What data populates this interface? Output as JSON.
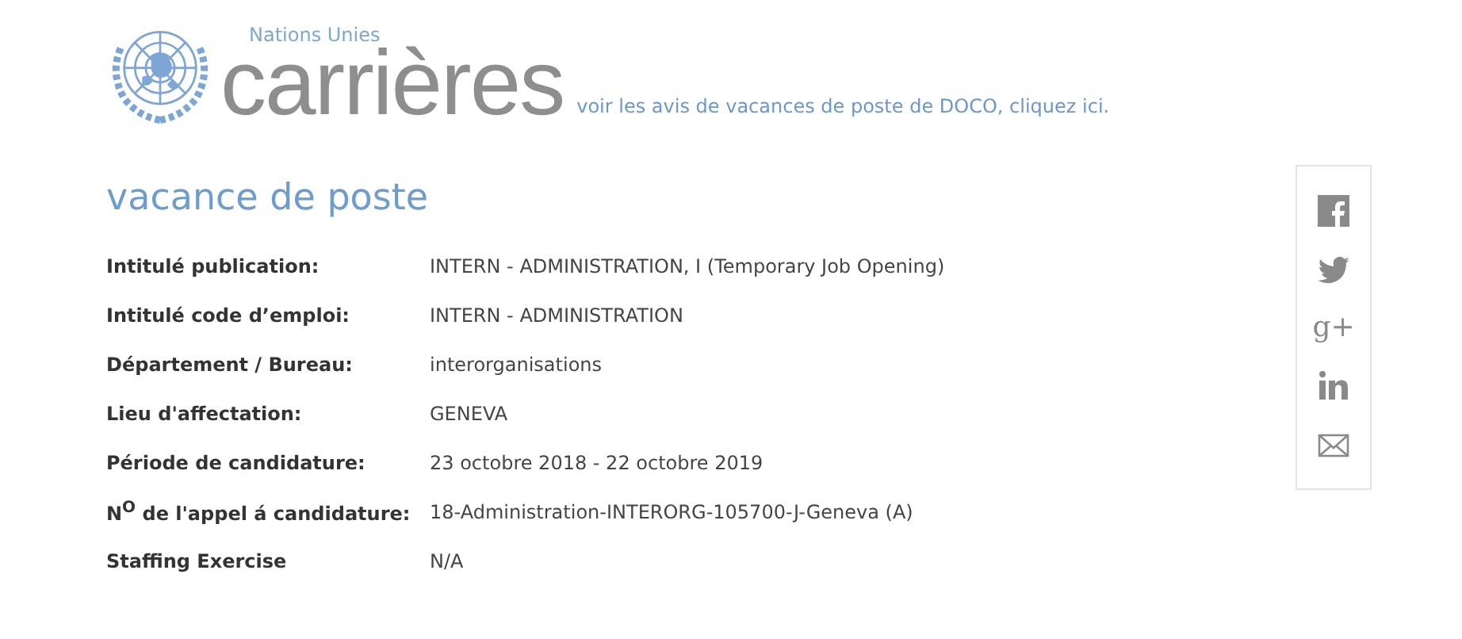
{
  "header": {
    "org": "Nations Unies",
    "title": "carrières",
    "link": "voir les avis de vacances de poste de DOCO, cliquez ici."
  },
  "heading": "vacance de poste",
  "fields": [
    {
      "label": "Intitulé publication:",
      "value": "INTERN - ADMINISTRATION, I (Temporary Job Opening)"
    },
    {
      "label": "Intitulé code d’emploi:",
      "value": "INTERN - ADMINISTRATION"
    },
    {
      "label": "Département / Bureau:",
      "value": "interorganisations"
    },
    {
      "label": "Lieu d'affectation:",
      "value": "GENEVA"
    },
    {
      "label": "Période de candidature:",
      "value": "23 octobre 2018 - 22 octobre 2019"
    },
    {
      "label": "N$^{O}$ de l'appel á candidature:",
      "value": "18-Administration-INTERORG-105700-J-Geneva (A)"
    },
    {
      "label": "Staffing Exercise",
      "value": "N/A"
    }
  ],
  "share": [
    {
      "kind": "facebook"
    },
    {
      "kind": "twitter"
    },
    {
      "kind": "googleplus",
      "text": "g+"
    },
    {
      "kind": "linkedin"
    },
    {
      "kind": "email"
    }
  ]
}
